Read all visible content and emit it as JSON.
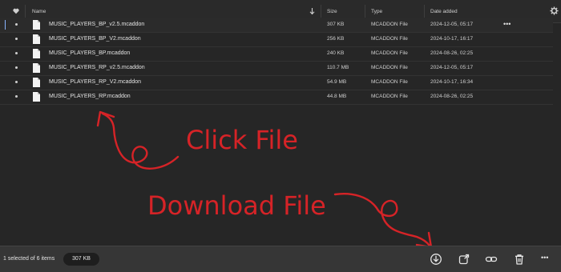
{
  "header": {
    "name_label": "Name",
    "size_label": "Size",
    "type_label": "Type",
    "date_label": "Date added"
  },
  "files": [
    {
      "name": "MUSIC_PLAYERS_BP_v2.5.mcaddon",
      "size": "307 KB",
      "type": "MCADDON File",
      "date": "2024-12-05, 05:17",
      "selected": true
    },
    {
      "name": "MUSIC_PLAYERS_BP_V2.mcaddon",
      "size": "256 KB",
      "type": "MCADDON File",
      "date": "2024-10-17, 16:17"
    },
    {
      "name": "MUSIC_PLAYERS_BP.mcaddon",
      "size": "240 KB",
      "type": "MCADDON File",
      "date": "2024-08-26, 02:25"
    },
    {
      "name": "MUSIC_PLAYERS_RP_v2.5.mcaddon",
      "size": "110.7 MB",
      "type": "MCADDON File",
      "date": "2024-12-05, 05:17"
    },
    {
      "name": "MUSIC_PLAYERS_RP_V2.mcaddon",
      "size": "54.9 MB",
      "type": "MCADDON File",
      "date": "2024-10-17, 16:34"
    },
    {
      "name": "MUSIC_PLAYERS_RP.mcaddon",
      "size": "44.8 MB",
      "type": "MCADDON File",
      "date": "2024-08-26, 02:25"
    }
  ],
  "row_more_label": "•••",
  "status": {
    "selection_text": "1 selected of 6 items",
    "selected_size": "307 KB"
  },
  "toolbar": {
    "more_label": "•••",
    "icons": [
      "download-icon",
      "share-icon",
      "link-icon",
      "trash-icon",
      "more-icon"
    ]
  },
  "annotations": {
    "click_text": "Click File",
    "download_text": "Download File",
    "color": "#d62327"
  },
  "colors": {
    "background": "#262626",
    "bottom_bar": "#363636",
    "selection_accent": "#8ab4ff",
    "annotation_red": "#d62327"
  }
}
